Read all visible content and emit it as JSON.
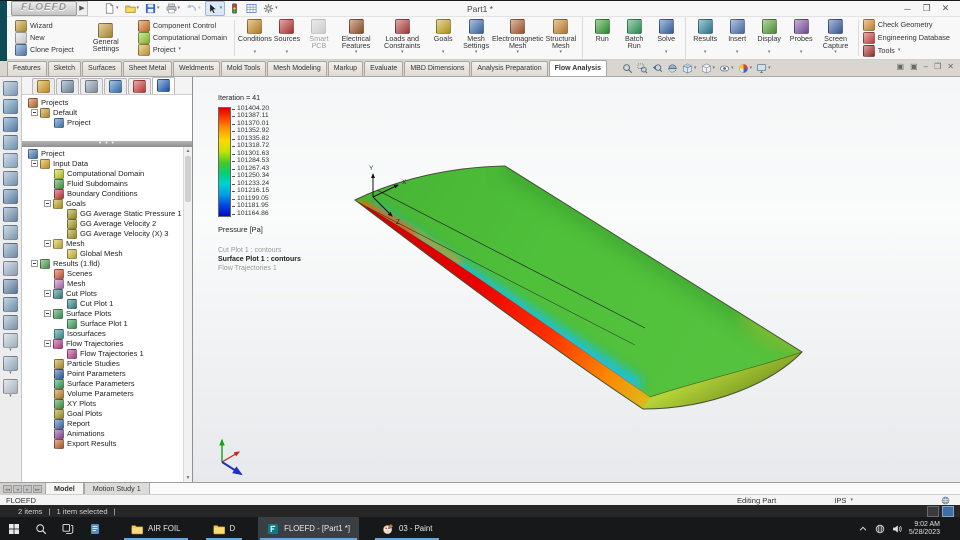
{
  "window": {
    "logo": "FLOEFD",
    "title": "Part1 *"
  },
  "quick_access": [
    {
      "icon": "new-document",
      "caret": true
    },
    {
      "icon": "open-folder",
      "caret": true
    },
    {
      "icon": "save",
      "caret": true
    },
    {
      "icon": "print",
      "caret": true
    },
    {
      "icon": "undo",
      "caret": true,
      "disabled": true
    },
    {
      "icon": "select-cursor",
      "caret": true,
      "boxed": true
    },
    {
      "icon": "traffic-light"
    },
    {
      "icon": "evaluate-grid"
    },
    {
      "icon": "options-gear",
      "caret": true
    }
  ],
  "ribbon": {
    "group_a": [
      {
        "label": "Wizard",
        "icon": "#c8a030"
      },
      {
        "label": "New",
        "icon": "#e4e4e4"
      },
      {
        "label": "Clone Project",
        "icon": "#5888c8"
      }
    ],
    "general_settings": {
      "label": "General Settings",
      "icon": "#c09838"
    },
    "group_a2": [
      {
        "label": "Component Control",
        "icon": "#d87828"
      },
      {
        "label": "Computational Domain",
        "icon": "#9ccc30"
      },
      {
        "label": "Project",
        "icon": "#d8a838",
        "caret": true
      }
    ],
    "large_buttons": [
      {
        "label": "Conditions",
        "icon": "#cc8c20",
        "caret": true
      },
      {
        "label": "Sources",
        "icon": "#c03838",
        "caret": true
      },
      {
        "label": "Smart PCB",
        "icon": "#b0b0b0",
        "disabled": true
      },
      {
        "label": "Electrical Features",
        "icon": "#a05828",
        "caret": true
      },
      {
        "label": "Loads and Constraints",
        "icon": "#b84040",
        "caret": true
      },
      {
        "label": "Goals",
        "icon": "#c8a818",
        "caret": true
      },
      {
        "label": "Mesh Settings",
        "icon": "#4070b0",
        "caret": true
      },
      {
        "label": "Electromagnetic Mesh",
        "icon": "#b06030",
        "caret": true
      },
      {
        "label": "Structural Mesh",
        "icon": "#cc8830",
        "caret": true
      },
      {
        "label": "Run",
        "icon": "#2f9e2f",
        "group_start": true
      },
      {
        "label": "Batch Run",
        "icon": "#2f9e5f"
      },
      {
        "label": "Solve",
        "icon": "#3a6ab0",
        "caret": true
      },
      {
        "label": "Results",
        "icon": "#2f86a0",
        "caret": true,
        "group_start": true
      },
      {
        "label": "Insert",
        "icon": "#5078b8",
        "caret": true
      },
      {
        "label": "Display",
        "icon": "#57a03a",
        "caret": true
      },
      {
        "label": "Probes",
        "icon": "#8055a8",
        "caret": true
      },
      {
        "label": "Screen Capture",
        "icon": "#3f62a8",
        "caret": true
      }
    ],
    "right_stack": [
      {
        "label": "Check Geometry",
        "icon": "#d89030"
      },
      {
        "label": "Engineering Database",
        "icon": "#d04848"
      },
      {
        "label": "Tools",
        "icon": "#b03030",
        "caret": true
      }
    ]
  },
  "command_tabs": [
    {
      "label": "Features"
    },
    {
      "label": "Sketch"
    },
    {
      "label": "Surfaces"
    },
    {
      "label": "Sheet Metal"
    },
    {
      "label": "Weldments"
    },
    {
      "label": "Mold Tools"
    },
    {
      "label": "Mesh Modeling"
    },
    {
      "label": "Markup"
    },
    {
      "label": "Evaluate"
    },
    {
      "label": "MBD Dimensions"
    },
    {
      "label": "Analysis Preparation"
    },
    {
      "label": "Flow Analysis",
      "active": true
    }
  ],
  "view_toolbar": [
    {
      "icon": "zoom-fit"
    },
    {
      "icon": "zoom-area"
    },
    {
      "icon": "zoom-previous"
    },
    {
      "icon": "section-view"
    },
    {
      "icon": "view-orientation-cube",
      "caret": true
    },
    {
      "icon": "display-style",
      "caret": true
    },
    {
      "icon": "hide-show-items",
      "caret": true
    },
    {
      "icon": "appearance-sphere",
      "caret": true
    },
    {
      "icon": "view-settings-monitor",
      "caret": true
    }
  ],
  "left_strip": [
    {
      "color": "#8fb0d0"
    },
    {
      "color": "#6f9cc0"
    },
    {
      "color": "#5f8cc0"
    },
    {
      "color": "#7fa8c8"
    },
    {
      "color": "#98b8d8"
    },
    {
      "color": "#88a8c8"
    },
    {
      "color": "#6890b8"
    },
    {
      "color": "#7898b8"
    },
    {
      "color": "#90b0c8"
    },
    {
      "color": "#80a0c0"
    },
    {
      "color": "#a0b8d0"
    },
    {
      "color": "#6888b0"
    },
    {
      "color": "#7ca4c4"
    },
    {
      "color": "#8cacc4"
    },
    {
      "color": "#b8ccd8",
      "caret": true
    },
    {
      "color": "#a8c0d4",
      "caret": true
    },
    {
      "color": "#c0ccd8",
      "caret": true
    }
  ],
  "feature_panel": {
    "tabs": [
      {
        "name": "panel-tab-features",
        "color": "#d8a020"
      },
      {
        "name": "panel-tab-configurations",
        "color": "#7a94ac"
      },
      {
        "name": "panel-tab-dimxpert",
        "color": "#90a0b0"
      },
      {
        "name": "panel-tab-display-manager",
        "color": "#3c7cc0"
      },
      {
        "name": "panel-tab-cam",
        "color": "#d04040"
      },
      {
        "name": "panel-tab-floefd",
        "color": "#1e5fc0",
        "active": true
      }
    ],
    "projects_tree": [
      {
        "label": "Projects",
        "depth": 0,
        "icon": "#c87830"
      },
      {
        "label": "Default",
        "depth": 1,
        "exp": true,
        "icon": "#d0a030"
      },
      {
        "label": "Project",
        "depth": 2,
        "icon": "#4a86c8"
      }
    ],
    "project_tree": [
      {
        "label": "Project",
        "depth": 0,
        "icon": "#4a86c8"
      },
      {
        "label": "Input Data",
        "depth": 1,
        "exp": true,
        "icon": "#e0ac28"
      },
      {
        "label": "Computational Domain",
        "depth": 2,
        "icon": "#cadc30"
      },
      {
        "label": "Fluid Subdomains",
        "depth": 2,
        "icon": "#52a84e"
      },
      {
        "label": "Boundary Conditions",
        "depth": 2,
        "icon": "#d24242"
      },
      {
        "label": "Goals",
        "depth": 2,
        "exp": true,
        "icon": "#c8aa1e"
      },
      {
        "label": "GG Average Static Pressure 1",
        "depth": 3,
        "icon": "#b0a426"
      },
      {
        "label": "GG Average Velocity 2",
        "depth": 3,
        "icon": "#b0a426"
      },
      {
        "label": "GG Average Velocity (X) 3",
        "depth": 3,
        "icon": "#b0a426"
      },
      {
        "label": "Mesh",
        "depth": 2,
        "exp": true,
        "icon": "#d8c23a"
      },
      {
        "label": "Global Mesh",
        "depth": 3,
        "icon": "#d8c23a"
      },
      {
        "label": "Results (1.fld)",
        "depth": 1,
        "exp": true,
        "icon": "#58a858"
      },
      {
        "label": "Scenes",
        "depth": 2,
        "icon": "#e06040"
      },
      {
        "label": "Mesh",
        "depth": 2,
        "icon": "#c27ec2"
      },
      {
        "label": "Cut Plots",
        "depth": 2,
        "exp": true,
        "icon": "#3f8f8f"
      },
      {
        "label": "Cut Plot 1",
        "depth": 3,
        "icon": "#3f8f8f"
      },
      {
        "label": "Surface Plots",
        "depth": 2,
        "exp": true,
        "icon": "#3fa85f"
      },
      {
        "label": "Surface Plot 1",
        "depth": 3,
        "icon": "#3fa85f"
      },
      {
        "label": "Isosurfaces",
        "depth": 2,
        "icon": "#3fa0a0"
      },
      {
        "label": "Flow Trajectories",
        "depth": 2,
        "exp": true,
        "icon": "#c84898"
      },
      {
        "label": "Flow Trajectories 1",
        "depth": 3,
        "icon": "#c84898"
      },
      {
        "label": "Particle Studies",
        "depth": 2,
        "icon": "#c8a030"
      },
      {
        "label": "Point Parameters",
        "depth": 2,
        "icon": "#3a68b0"
      },
      {
        "label": "Surface Parameters",
        "depth": 2,
        "icon": "#3fa860"
      },
      {
        "label": "Volume Parameters",
        "depth": 2,
        "icon": "#c89030"
      },
      {
        "label": "XY Plots",
        "depth": 2,
        "icon": "#4aa04a"
      },
      {
        "label": "Goal Plots",
        "depth": 2,
        "icon": "#b0a426"
      },
      {
        "label": "Report",
        "depth": 2,
        "icon": "#4878c0"
      },
      {
        "label": "Animations",
        "depth": 2,
        "icon": "#9a52aa"
      },
      {
        "label": "Export Results",
        "depth": 2,
        "icon": "#c86830"
      }
    ]
  },
  "legend": {
    "iteration": "Iteration = 41",
    "values": [
      {
        "v": "101404.20"
      },
      {
        "v": "101387.11"
      },
      {
        "v": "101370.01"
      },
      {
        "v": "101352.92"
      },
      {
        "v": "101335.82"
      },
      {
        "v": "101318.72"
      },
      {
        "v": "101301.63"
      },
      {
        "v": "101284.53"
      },
      {
        "v": "101267.43"
      },
      {
        "v": "101250.34"
      },
      {
        "v": "101233.24"
      },
      {
        "v": "101216.15"
      },
      {
        "v": "101199.05"
      },
      {
        "v": "101181.95"
      },
      {
        "v": "101164.86"
      }
    ],
    "unit": "Pressure [Pa]",
    "plots": [
      {
        "label": "Cut Plot 1 : contours",
        "dim": true
      },
      {
        "label": "Surface Plot 1 : contours",
        "bold": true
      },
      {
        "label": "Flow Trajectories 1",
        "dim": true
      }
    ]
  },
  "triad": {
    "x": "X",
    "y": "Y",
    "z": "Z"
  },
  "model_tabs": [
    {
      "label": "Model",
      "active": true
    },
    {
      "label": "Motion Study 1"
    }
  ],
  "status_bar": {
    "left": "FLOEFD",
    "editing": "Editing Part",
    "units": "IPS"
  },
  "explorer_bar": {
    "items": "2 items",
    "sep1": "|",
    "selected": "1 item selected",
    "sep2": "|"
  },
  "taskbar": {
    "apps": [
      {
        "label": "AIR FOIL",
        "icon": "folder",
        "open": true
      },
      {
        "label": "D",
        "icon": "folder",
        "open": true
      },
      {
        "label": "FLOEFD - [Part1 *]",
        "icon": "floefd",
        "open": true,
        "active": true
      },
      {
        "label": "03 - Paint",
        "icon": "paint",
        "open": true
      }
    ],
    "clock": {
      "time": "9:02 AM",
      "date": "5/28/2023"
    }
  }
}
